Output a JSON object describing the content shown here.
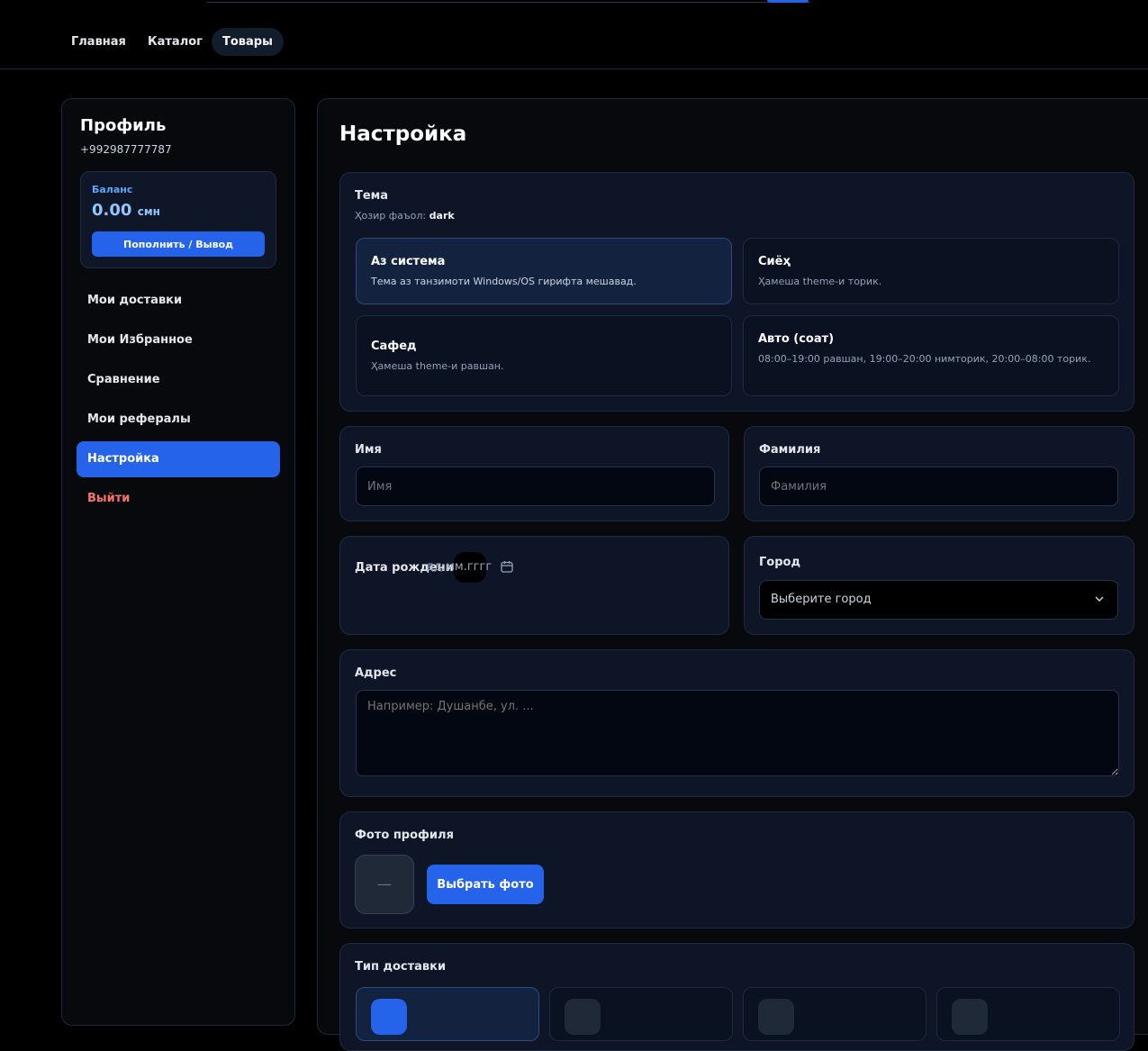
{
  "nav": {
    "items": [
      {
        "label": "Главная"
      },
      {
        "label": "Каталог"
      },
      {
        "label": "Товары"
      }
    ]
  },
  "sidebar": {
    "title": "Профиль",
    "phone": "+992987777787",
    "balance": {
      "label": "Баланс",
      "amount": "0.00",
      "currency": "смн",
      "button": "Пополнить / Вывод"
    },
    "items": [
      {
        "label": "Мои доставки"
      },
      {
        "label": "Мои Избранное"
      },
      {
        "label": "Сравнение"
      },
      {
        "label": "Мои рефералы"
      },
      {
        "label": "Настройка"
      },
      {
        "label": "Выйти"
      }
    ]
  },
  "main": {
    "title": "Настройка",
    "theme": {
      "label": "Тема",
      "current_prefix": "Ҳозир фаъол:",
      "current_value": "dark",
      "options": [
        {
          "title": "Аз система",
          "desc": "Тема аз танзимоти Windows/OS гирифта мешавад."
        },
        {
          "title": "Сиёҳ",
          "desc": "Ҳамеша theme-и торик."
        },
        {
          "title": "Сафед",
          "desc": "Ҳамеша theme-и равшан."
        },
        {
          "title": "Авто (соат)",
          "desc": "08:00–19:00 равшан, 19:00–20:00 нимторик, 20:00–08:00 торик."
        }
      ]
    },
    "first_name": {
      "label": "Имя",
      "placeholder": "Имя"
    },
    "last_name": {
      "label": "Фамилия",
      "placeholder": "Фамилия"
    },
    "birth_date": {
      "label": "Дата рождения",
      "placeholder": "дд.мм.гггг"
    },
    "city": {
      "label": "Город",
      "selected": "Выберите город"
    },
    "address": {
      "label": "Адрес",
      "placeholder": "Например: Душанбе, ул. ..."
    },
    "photo": {
      "label": "Фото профиля",
      "empty": "—",
      "button": "Выбрать фото"
    },
    "delivery": {
      "label": "Тип доставки"
    }
  },
  "colors": {
    "accent": "#2563eb",
    "background": "#000000",
    "card": "#0d1526",
    "danger": "#f87171"
  }
}
